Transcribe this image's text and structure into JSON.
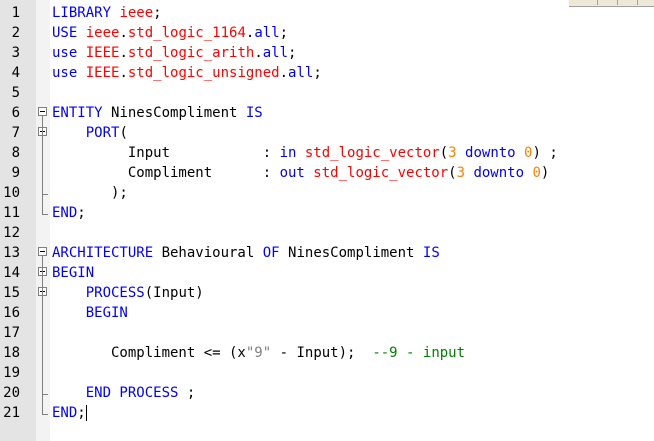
{
  "editor": {
    "lines": [
      {
        "n": "1",
        "tokens": [
          {
            "t": "LIBRARY ",
            "c": "kw"
          },
          {
            "t": "ieee",
            "c": "ty"
          },
          {
            "t": ";",
            "c": "p"
          }
        ]
      },
      {
        "n": "2",
        "tokens": [
          {
            "t": "USE ",
            "c": "kw"
          },
          {
            "t": "ieee",
            "c": "ty"
          },
          {
            "t": ".",
            "c": "p"
          },
          {
            "t": "std_logic_1164",
            "c": "ty"
          },
          {
            "t": ".",
            "c": "p"
          },
          {
            "t": "all",
            "c": "kw"
          },
          {
            "t": ";",
            "c": "p"
          }
        ]
      },
      {
        "n": "3",
        "tokens": [
          {
            "t": "use ",
            "c": "kw"
          },
          {
            "t": "IEEE",
            "c": "ty"
          },
          {
            "t": ".",
            "c": "p"
          },
          {
            "t": "std_logic_arith",
            "c": "ty"
          },
          {
            "t": ".",
            "c": "p"
          },
          {
            "t": "all",
            "c": "kw"
          },
          {
            "t": ";",
            "c": "p"
          }
        ]
      },
      {
        "n": "4",
        "tokens": [
          {
            "t": "use ",
            "c": "kw"
          },
          {
            "t": "IEEE",
            "c": "ty"
          },
          {
            "t": ".",
            "c": "p"
          },
          {
            "t": "std_logic_unsigned",
            "c": "ty"
          },
          {
            "t": ".",
            "c": "p"
          },
          {
            "t": "all",
            "c": "kw"
          },
          {
            "t": ";",
            "c": "p"
          }
        ]
      },
      {
        "n": "5",
        "tokens": []
      },
      {
        "n": "6",
        "tokens": [
          {
            "t": "ENTITY ",
            "c": "kw"
          },
          {
            "t": "NinesCompliment ",
            "c": "p"
          },
          {
            "t": "IS",
            "c": "kw"
          }
        ]
      },
      {
        "n": "7",
        "tokens": [
          {
            "t": "    ",
            "c": "p"
          },
          {
            "t": "PORT",
            "c": "kw"
          },
          {
            "t": "(",
            "c": "p"
          }
        ]
      },
      {
        "n": "8",
        "tokens": [
          {
            "t": "         Input           : ",
            "c": "p"
          },
          {
            "t": "in ",
            "c": "kw"
          },
          {
            "t": "std_logic_vector",
            "c": "ty"
          },
          {
            "t": "(",
            "c": "p"
          },
          {
            "t": "3 ",
            "c": "num"
          },
          {
            "t": "downto ",
            "c": "kw"
          },
          {
            "t": "0",
            "c": "num"
          },
          {
            "t": ") ;",
            "c": "p"
          }
        ]
      },
      {
        "n": "9",
        "tokens": [
          {
            "t": "         Compliment      : ",
            "c": "p"
          },
          {
            "t": "out ",
            "c": "kw"
          },
          {
            "t": "std_logic_vector",
            "c": "ty"
          },
          {
            "t": "(",
            "c": "p"
          },
          {
            "t": "3 ",
            "c": "num"
          },
          {
            "t": "downto ",
            "c": "kw"
          },
          {
            "t": "0",
            "c": "num"
          },
          {
            "t": ")",
            "c": "p"
          }
        ]
      },
      {
        "n": "10",
        "tokens": [
          {
            "t": "       );",
            "c": "p"
          }
        ]
      },
      {
        "n": "11",
        "tokens": [
          {
            "t": "END",
            "c": "kw"
          },
          {
            "t": ";",
            "c": "p"
          }
        ]
      },
      {
        "n": "12",
        "tokens": []
      },
      {
        "n": "13",
        "tokens": [
          {
            "t": "ARCHITECTURE ",
            "c": "kw"
          },
          {
            "t": "Behavioural ",
            "c": "p"
          },
          {
            "t": "OF ",
            "c": "kw"
          },
          {
            "t": "NinesCompliment ",
            "c": "p"
          },
          {
            "t": "IS",
            "c": "kw"
          }
        ]
      },
      {
        "n": "14",
        "tokens": [
          {
            "t": "BEGIN",
            "c": "kw"
          }
        ]
      },
      {
        "n": "15",
        "tokens": [
          {
            "t": "    ",
            "c": "p"
          },
          {
            "t": "PROCESS",
            "c": "kw"
          },
          {
            "t": "(Input)",
            "c": "p"
          }
        ]
      },
      {
        "n": "16",
        "tokens": [
          {
            "t": "    ",
            "c": "p"
          },
          {
            "t": "BEGIN",
            "c": "kw"
          }
        ]
      },
      {
        "n": "17",
        "tokens": []
      },
      {
        "n": "18",
        "tokens": [
          {
            "t": "       Compliment <= (x",
            "c": "p"
          },
          {
            "t": "\"9\"",
            "c": "str"
          },
          {
            "t": " - Input);  ",
            "c": "p"
          },
          {
            "t": "--9 - input",
            "c": "cm"
          }
        ]
      },
      {
        "n": "19",
        "tokens": []
      },
      {
        "n": "20",
        "tokens": [
          {
            "t": "    ",
            "c": "p"
          },
          {
            "t": "END PROCESS ",
            "c": "kw"
          },
          {
            "t": ";",
            "c": "p"
          }
        ]
      },
      {
        "n": "21",
        "tokens": [
          {
            "t": "END",
            "c": "kw"
          },
          {
            "t": ";",
            "c": "p"
          }
        ]
      }
    ]
  },
  "colors": {
    "keyword": "#0000ff",
    "type": "#ff0000",
    "number": "#ff8000",
    "string": "#808080",
    "comment": "#008000",
    "gutter": "#e4e4e4"
  }
}
